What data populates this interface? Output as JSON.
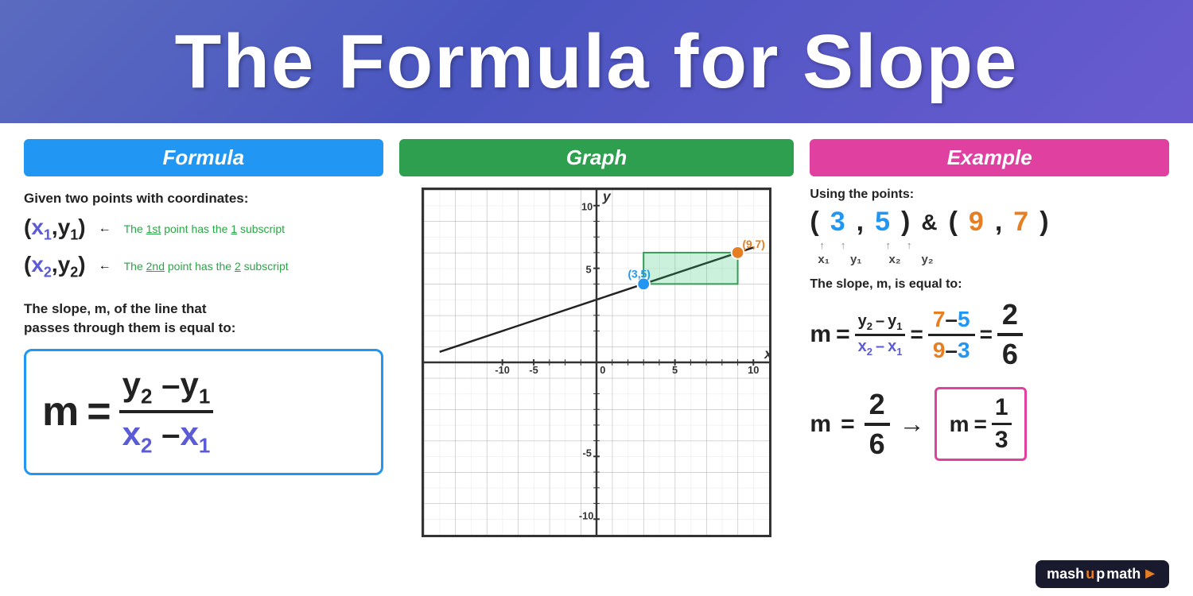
{
  "header": {
    "title": "The Formula for Slope"
  },
  "formula": {
    "section_label": "Formula",
    "given_text": "Given two points with coordinates:",
    "point1_display": "(x₁,y₁)",
    "point1_arrow": "←",
    "point1_note": "The 1st point has the 1 subscript",
    "point2_display": "(x₂,y₂)",
    "point2_arrow": "←",
    "point2_note": "The 2nd point has the 2 subscript",
    "slope_desc_line1": "The slope, m, of the line that",
    "slope_desc_line2": "passes through them is equal to:",
    "m_label": "m",
    "equals": "=",
    "numerator": "y₂ –y₁",
    "denominator": "x₂ –x₁"
  },
  "graph": {
    "section_label": "Graph",
    "point1_label": "(3,5)",
    "point2_label": "(9,7)",
    "x_axis_label": "x",
    "y_axis_label": "y",
    "grid_min": -10,
    "grid_max": 10
  },
  "example": {
    "section_label": "Example",
    "using_text": "Using the points:",
    "point1_x": "3",
    "point1_y": "5",
    "point2_x": "9",
    "point2_y": "7",
    "ampersand": "&",
    "x1_label": "x₁",
    "y1_label": "y₁",
    "x2_label": "x₂",
    "y2_label": "y₂",
    "slope_label_text": "The slope, m, is equal to:",
    "m": "m",
    "eq": "=",
    "frac_num_vars": "y₂ –y₁",
    "frac_den_vars": "x₂ –x₁",
    "eq2": "=",
    "frac_num_vals": "7–5",
    "frac_den_vals": "9–3",
    "eq3": "=",
    "frac_num_result": "2",
    "frac_den_result": "6",
    "m2": "m",
    "eq4": "=",
    "frac_num_final": "2",
    "frac_den_final": "6",
    "arrow": "→",
    "final_m": "m",
    "final_eq": "=",
    "final_num": "1",
    "final_den": "3"
  },
  "branding": {
    "text_part1": "mash",
    "text_o": "u",
    "text_part2": "p",
    "text_math": "math",
    "play_icon": "►"
  }
}
